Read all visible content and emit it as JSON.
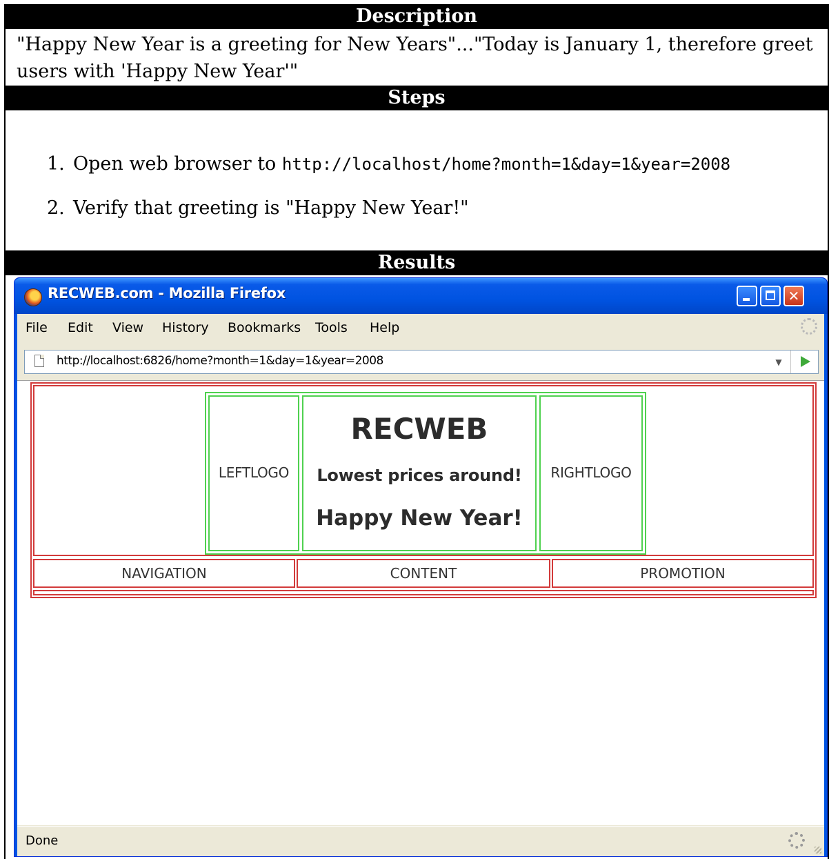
{
  "doc": {
    "description_header": "Description",
    "description_text": "\"Happy New Year is a greeting for New Years\"...\"Today is January 1, therefore greet users with 'Happy New Year'\"",
    "steps_header": "Steps",
    "steps": [
      {
        "num": "1.",
        "text": "Open web browser to ",
        "code": "http://localhost/home?month=1&day=1&year=2008"
      },
      {
        "num": "2.",
        "text": "Verify that greeting is \"Happy New Year!\"",
        "code": ""
      }
    ],
    "results_header": "Results"
  },
  "browser": {
    "title": "RECWEB.com - Mozilla Firefox",
    "menu": [
      "File",
      "Edit",
      "View",
      "History",
      "Bookmarks",
      "Tools",
      "Help"
    ],
    "url": "http://localhost:6826/home?month=1&day=1&year=2008",
    "dropdown_glyph": "▼",
    "status": "Done"
  },
  "page": {
    "left_logo": "LEFTLOGO",
    "brand": "RECWEB",
    "tagline": "Lowest prices around!",
    "greeting": "Happy New Year!",
    "right_logo": "RIGHTLOGO",
    "sections": [
      "NAVIGATION",
      "CONTENT",
      "PROMOTION"
    ]
  },
  "colors": {
    "table_border": "#d23a3a",
    "logo_border": "#4fd14f",
    "titlebar": "#0054e3"
  },
  "icons": {
    "app": "firefox-icon",
    "page": "page-icon",
    "go": "go-arrow-icon",
    "throbber": "throbber-icon",
    "status": "gear-icon"
  }
}
